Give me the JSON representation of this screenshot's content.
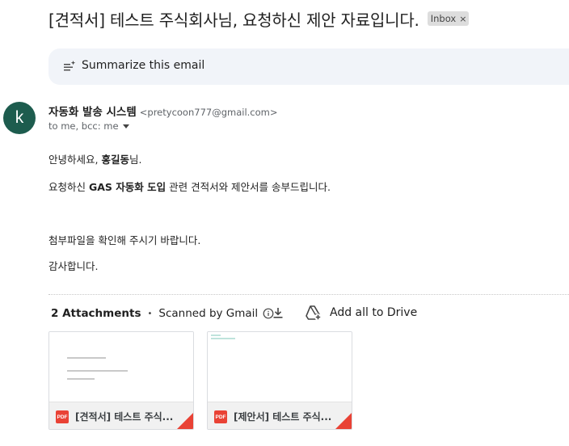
{
  "email": {
    "subject": "[견적서] 테스트 주식회사님, 요청하신 제안 자료입니다.",
    "label_chip": "Inbox",
    "label_chip_close": "×"
  },
  "summarize": {
    "label": "Summarize this email",
    "icon": "sparkle-lines-icon"
  },
  "sender": {
    "avatar_letter": "k",
    "avatar_color": "#1d5c4e",
    "name": "자동화 발송 시스템",
    "email": "<pretycoon777@gmail.com>",
    "recipients": "to me, bcc: me"
  },
  "body": {
    "greeting_prefix": "안녕하세요, ",
    "greeting_name": "홍길동",
    "greeting_suffix": "님.",
    "line2_prefix": "요청하신 ",
    "line2_bold": "GAS 자동화 도입",
    "line2_suffix": " 관련 견적서와 제안서를 송부드립니다.",
    "line3": "첨부파일을 확인해 주시기 바랍니다.",
    "line4": "감사합니다."
  },
  "attachments": {
    "count_label": "2 Attachments",
    "separator": "•",
    "scanned_label": "Scanned by Gmail",
    "add_all_label": "Add all to Drive",
    "pdf_badge": "PDF",
    "items": [
      {
        "name": "[견적서] 테스트 주식...",
        "type": "PDF"
      },
      {
        "name": "[제안서] 테스트 주식...",
        "type": "PDF"
      }
    ]
  },
  "colors": {
    "accent_pdf": "#e94235",
    "summarize_bg": "#f1f4f9"
  }
}
